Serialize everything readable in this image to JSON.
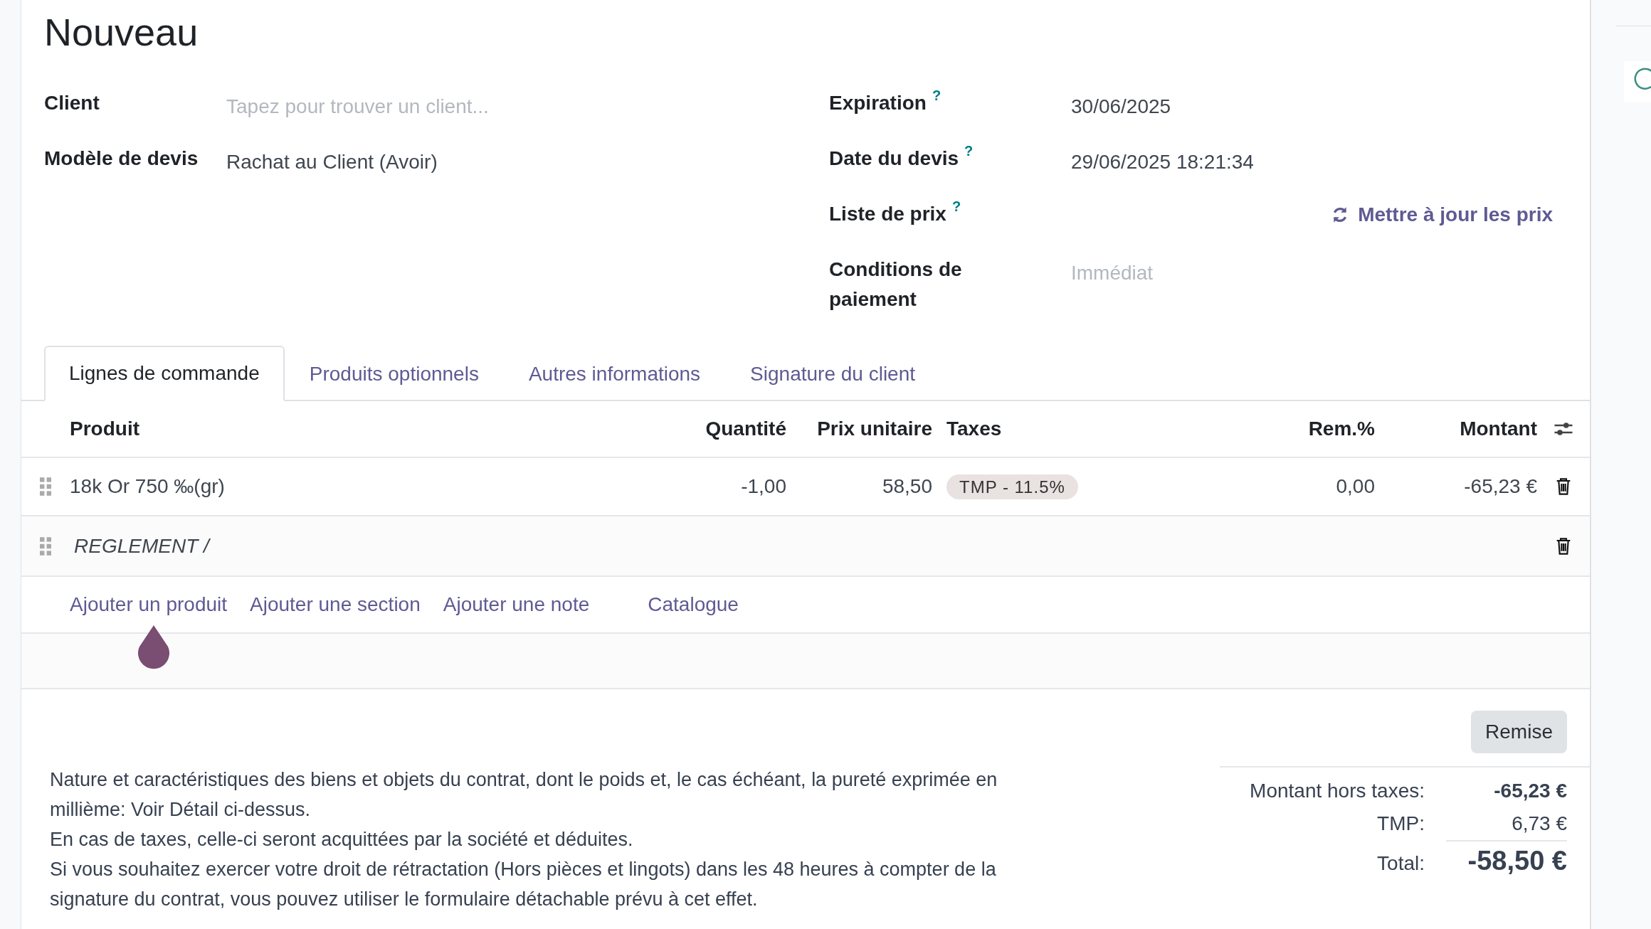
{
  "title": "Nouveau",
  "fields_left": [
    {
      "label": "Client",
      "placeholder": "Tapez pour trouver un client..."
    },
    {
      "label": "Modèle de devis",
      "value": "Rachat au Client (Avoir)"
    }
  ],
  "fields_right": [
    {
      "label": "Expiration",
      "help": "?",
      "value": "30/06/2025"
    },
    {
      "label": "Date du devis",
      "help": "?",
      "value": "29/06/2025 18:21:34"
    },
    {
      "label": "Liste de prix",
      "help": "?",
      "action": "Mettre à jour les prix"
    },
    {
      "label": "Conditions de paiement",
      "placeholder": "Immédiat"
    }
  ],
  "tabs": [
    {
      "label": "Lignes de commande",
      "selected": true
    },
    {
      "label": "Produits optionnels",
      "selected": false
    },
    {
      "label": "Autres informations",
      "selected": false
    },
    {
      "label": "Signature du client",
      "selected": false
    }
  ],
  "table": {
    "columns": [
      "Produit",
      "Quantité",
      "Prix unitaire",
      "Taxes",
      "Rem.%",
      "Montant"
    ],
    "rows": [
      {
        "kind": "product",
        "product": "18k Or 750 ‰(gr)",
        "quantity": "-1,00",
        "unit_price": "58,50",
        "taxes": [
          "TMP - 11.5%"
        ],
        "discount": "0,00",
        "amount": "-65,23 €"
      },
      {
        "kind": "note",
        "text": "REGLEMENT /"
      }
    ],
    "add_links": [
      "Ajouter un produit",
      "Ajouter une section",
      "Ajouter une note",
      "Catalogue"
    ]
  },
  "discount_button": "Remise",
  "terms": [
    "Nature et caractéristiques des biens et objets du contrat, dont le poids et, le cas échéant, la pureté exprimée en millième: Voir Détail ci-dessus.",
    "En cas de taxes, celle-ci seront acquittées par la société et déduites.",
    "Si vous souhaitez exercer votre droit de rétractation (Hors pièces et lingots) dans les 48 heures à compter de la signature du contrat, vous pouvez utiliser le formulaire détachable prévu à cet effet."
  ],
  "totals": [
    {
      "label": "Montant hors taxes:",
      "value": "-65,23 €",
      "kind": "subtotal"
    },
    {
      "label": "TMP:",
      "value": "6,73 €",
      "kind": "tax"
    },
    {
      "label": "Total:",
      "value": "-58,50 €",
      "kind": "total"
    }
  ]
}
